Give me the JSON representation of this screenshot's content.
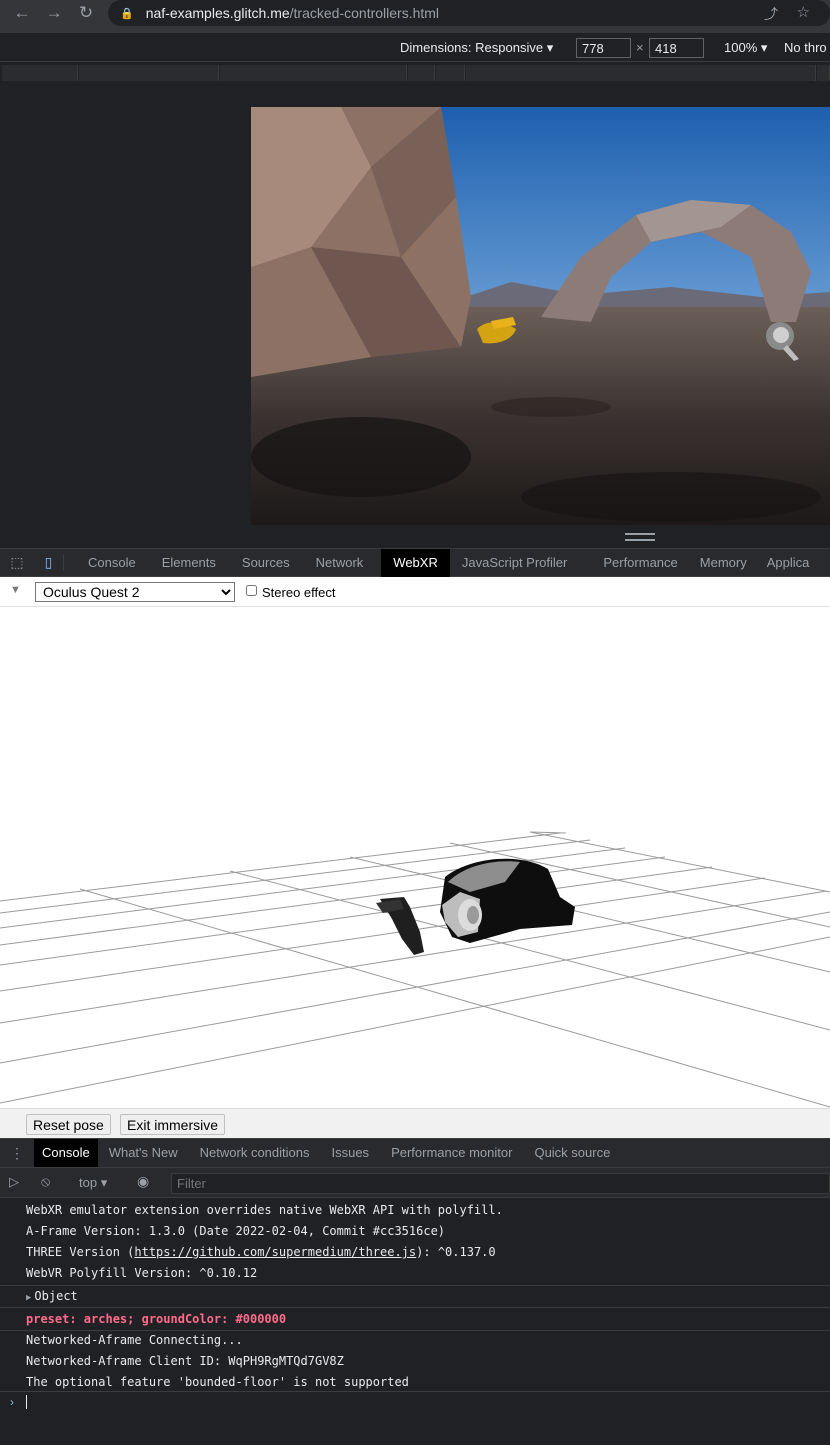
{
  "browser": {
    "url_host": "naf-examples.glitch.me",
    "url_path": "/tracked-controllers.html",
    "icons": [
      "back-arrow-icon",
      "forward-arrow-icon",
      "reload-icon",
      "lock-icon",
      "share-icon",
      "star-icon"
    ]
  },
  "device_toolbar": {
    "dimensions_label": "Dimensions: Responsive",
    "width": "778",
    "times": "×",
    "height": "418",
    "zoom": "100%",
    "throttle": "No thro"
  },
  "devtools": {
    "tabs": [
      "Console",
      "Elements",
      "Sources",
      "Network",
      "WebXR",
      "JavaScript Profiler",
      "Performance",
      "Memory",
      "Applica"
    ],
    "active_tab": "WebXR"
  },
  "webxr": {
    "device": "Oculus Quest 2",
    "device_options": [
      "Oculus Quest 2"
    ],
    "stereo_label": "Stereo effect",
    "reset_pose": "Reset pose",
    "exit_immersive": "Exit immersive"
  },
  "drawer": {
    "tabs": [
      "Console",
      "What's New",
      "Network conditions",
      "Issues",
      "Performance monitor",
      "Quick source"
    ],
    "active_tab": "Console",
    "context": "top",
    "filter_placeholder": "Filter"
  },
  "console": {
    "line1": "WebXR emulator extension overrides native WebXR API with polyfill.",
    "line2": "A-Frame Version: 1.3.0 (Date 2022-02-04, Commit #cc3516ce)",
    "line3_prefix": "THREE Version (",
    "line3_link": "https://github.com/supermedium/three.js",
    "line3_suffix": "): ^0.137.0",
    "line4": "WebVR Polyfill Version: ^0.10.12",
    "line5": "Object",
    "line6": "preset: arches; groundColor: #000000",
    "line7": "Networked-Aframe Connecting...",
    "line8": "Networked-Aframe Client ID: WqPH9RgMTQd7GV8Z",
    "line9": "The optional feature 'bounded-floor' is not supported",
    "error_color": "#ff6b8b"
  }
}
